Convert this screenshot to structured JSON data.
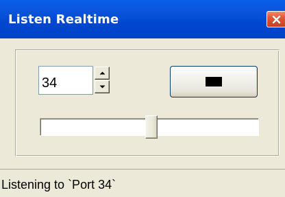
{
  "window": {
    "title": "Listen Realtime"
  },
  "port_spinner": {
    "value": "34"
  },
  "slider": {
    "position_fraction": 0.51
  },
  "status_bar": {
    "text": "Listening to `Port 34`"
  },
  "icons": {
    "close": "close-icon",
    "spin_up": "arrow-up-icon",
    "spin_down": "arrow-down-icon",
    "stop": "stop-icon"
  },
  "colors": {
    "titlebar": "#0a54dc",
    "close_button": "#e0563a",
    "client_background": "#ece9d8",
    "stop_icon": "#000000"
  }
}
